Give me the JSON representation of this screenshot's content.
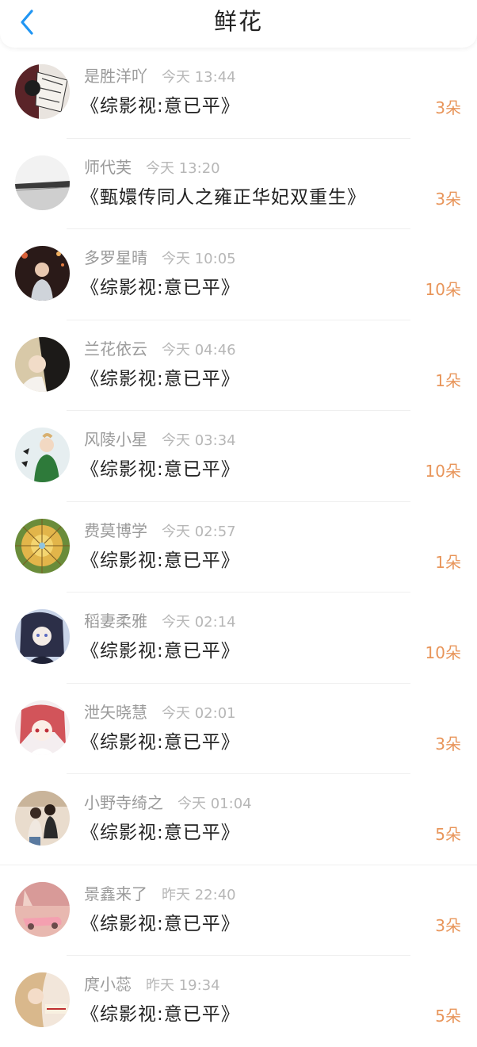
{
  "header": {
    "title": "鲜花",
    "back_icon": "chevron-left-icon",
    "accent_color": "#2196f3"
  },
  "colors": {
    "count": "#e8955a",
    "username": "#9a9a9a",
    "time": "#b7b7b7",
    "book": "#222222"
  },
  "items": [
    {
      "username": "是胜洋吖",
      "time": "今天 13:44",
      "book": "《综影视:意已平》",
      "count": "3朵"
    },
    {
      "username": "师代芙",
      "time": "今天 13:20",
      "book": "《甄嬛传同人之雍正华妃双重生》",
      "count": "3朵"
    },
    {
      "username": "多罗星晴",
      "time": "今天 10:05",
      "book": "《综影视:意已平》",
      "count": "10朵"
    },
    {
      "username": "兰花依云",
      "time": "今天 04:46",
      "book": "《综影视:意已平》",
      "count": "1朵"
    },
    {
      "username": "风陵小星",
      "time": "今天 03:34",
      "book": "《综影视:意已平》",
      "count": "10朵"
    },
    {
      "username": "费莫博学",
      "time": "今天 02:57",
      "book": "《综影视:意已平》",
      "count": "1朵"
    },
    {
      "username": "稻妻柔雅",
      "time": "今天 02:14",
      "book": "《综影视:意已平》",
      "count": "10朵"
    },
    {
      "username": "泄矢晓慧",
      "time": "今天 02:01",
      "book": "《综影视:意已平》",
      "count": "3朵"
    },
    {
      "username": "小野寺绮之",
      "time": "今天 01:04",
      "book": "《综影视:意已平》",
      "count": "5朵"
    },
    {
      "username": "景鑫来了",
      "time": "昨天 22:40",
      "book": "《综影视:意已平》",
      "count": "3朵"
    },
    {
      "username": "庹小蕊",
      "time": "昨天 19:34",
      "book": "《综影视:意已平》",
      "count": "5朵"
    }
  ]
}
